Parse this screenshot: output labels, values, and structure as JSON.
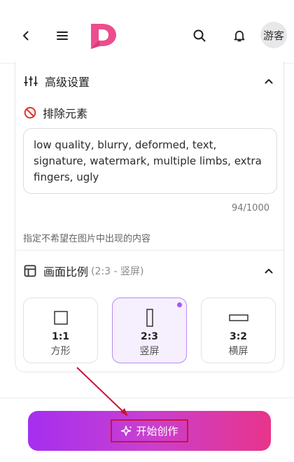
{
  "header": {
    "guest_label": "游客"
  },
  "advanced_settings": {
    "title": "高级设置"
  },
  "negative_prompt": {
    "title": "排除元素",
    "value": "low quality, blurry, deformed, text, signature, watermark, multiple limbs, extra fingers, ugly",
    "counter": "94/1000",
    "hint": "指定不希望在图片中出现的内容"
  },
  "aspect_ratio": {
    "title": "画面比例",
    "selected_summary": "(2:3 - 竖屏)",
    "options": [
      {
        "value": "1:1",
        "label": "方形"
      },
      {
        "value": "2:3",
        "label": "竖屏"
      },
      {
        "value": "3:2",
        "label": "横屏"
      }
    ],
    "selected_index": 1
  },
  "start_button": {
    "label": "开始创作"
  },
  "colors": {
    "brand": "#e8348a",
    "accent": "#a855f7",
    "annotation": "#c9143a"
  }
}
